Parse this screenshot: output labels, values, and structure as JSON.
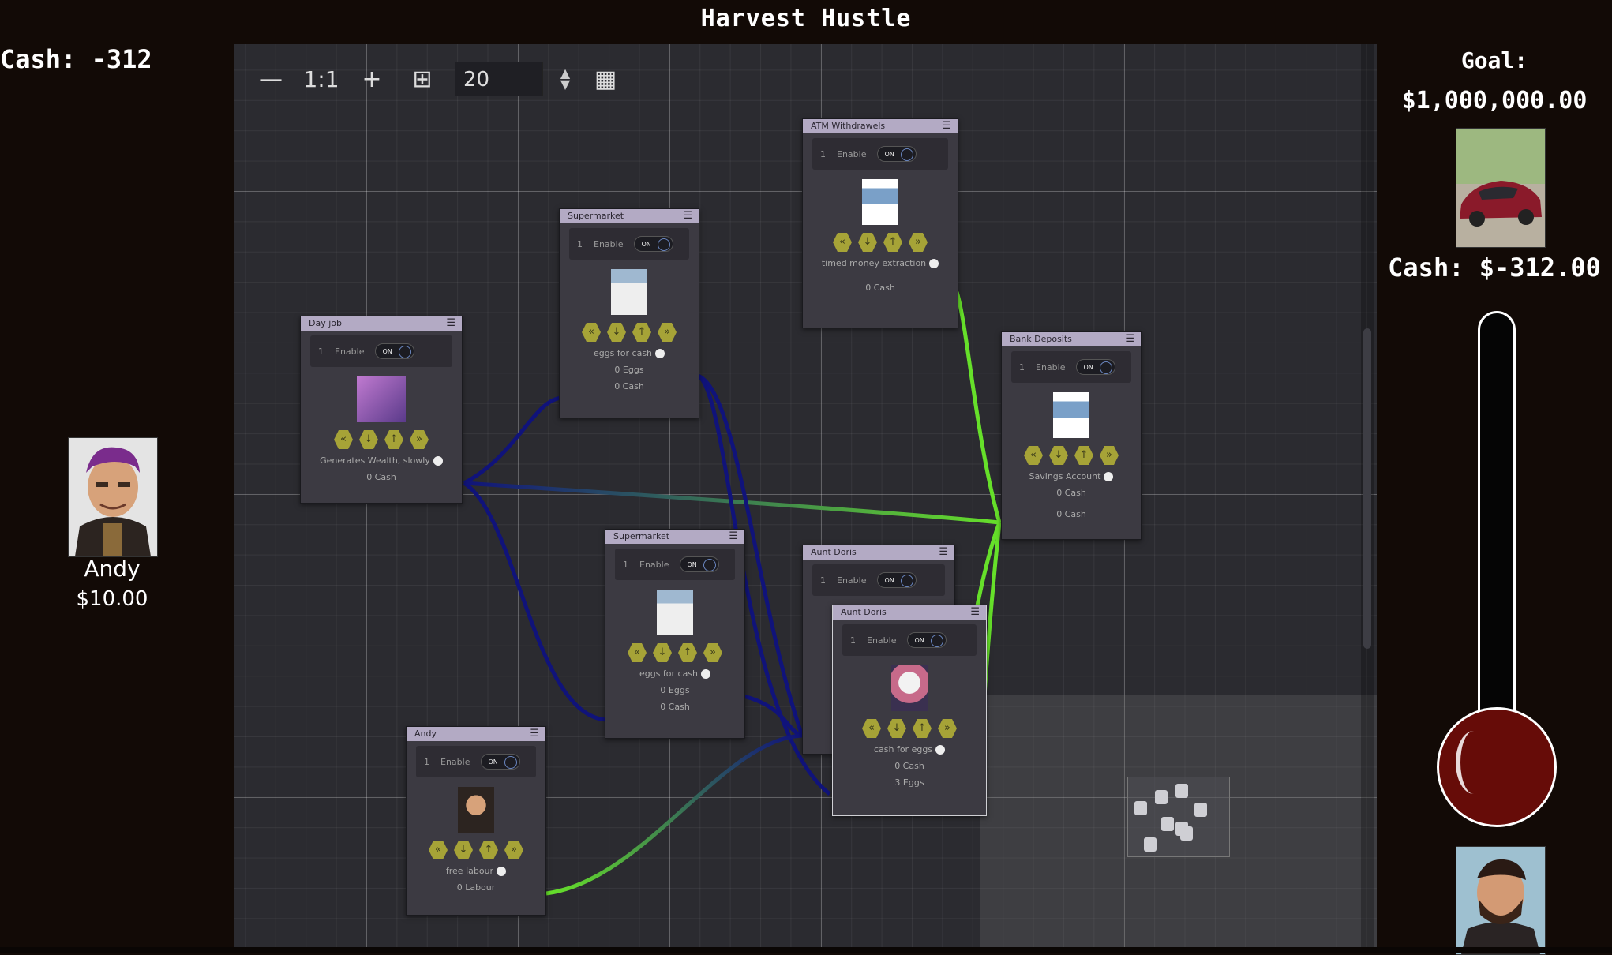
{
  "window": {
    "title": "Harvest Hustle"
  },
  "left_panel": {
    "cash_label": "Cash: -312",
    "character": {
      "name": "Andy",
      "money": "$10.00",
      "avatar_icon": "andy-portrait"
    }
  },
  "toolbar": {
    "zoom_out": "—",
    "zoom_reset": "1:1",
    "zoom_in": "+",
    "snap_icon": "⊞",
    "snap_value": "20",
    "map_icon": "▦"
  },
  "nodes": {
    "day_job": {
      "title": "Day job",
      "enable_num": "1",
      "enable_label": "Enable",
      "toggle": "ON",
      "desc": "Generates Wealth, slowly",
      "line1": "0 Cash"
    },
    "supermarket1": {
      "title": "Supermarket",
      "enable_num": "1",
      "enable_label": "Enable",
      "toggle": "ON",
      "desc": "eggs for cash",
      "line1": "0 Eggs",
      "line2": "0 Cash"
    },
    "atm": {
      "title": "ATM Withdrawels",
      "enable_num": "1",
      "enable_label": "Enable",
      "toggle": "ON",
      "desc": "timed money extraction",
      "line1": "0 Cash"
    },
    "bank": {
      "title": "Bank Deposits",
      "enable_num": "1",
      "enable_label": "Enable",
      "toggle": "ON",
      "desc": "Savings Account",
      "line1": "0 Cash",
      "line2": "0 Cash"
    },
    "supermarket2": {
      "title": "Supermarket",
      "enable_num": "1",
      "enable_label": "Enable",
      "toggle": "ON",
      "desc": "eggs for cash",
      "line1": "0 Eggs",
      "line2": "0 Cash"
    },
    "aunt_doris_back": {
      "title": "Aunt Doris",
      "enable_num": "1",
      "enable_label": "Enable",
      "toggle": "ON"
    },
    "aunt_doris": {
      "title": "Aunt Doris",
      "enable_num": "1",
      "enable_label": "Enable",
      "toggle": "ON",
      "desc": "cash for eggs",
      "line1": "0 Cash",
      "line2": "3 Eggs"
    },
    "andy": {
      "title": "Andy",
      "enable_num": "1",
      "enable_label": "Enable",
      "toggle": "ON",
      "desc": "free labour",
      "line1": "0 Labour"
    }
  },
  "right_panel": {
    "goal_label": "Goal:",
    "goal_value": "$1,000,000.00",
    "cash_label": "Cash: $-312.00",
    "goal_image_icon": "red-sports-car",
    "bottom_avatar_icon": "bearded-man-portrait"
  },
  "colors": {
    "wire_blue": "#10137a",
    "wire_green": "#66e02a",
    "accent_hex": "#a6a337",
    "node_header": "#b3aac4"
  }
}
